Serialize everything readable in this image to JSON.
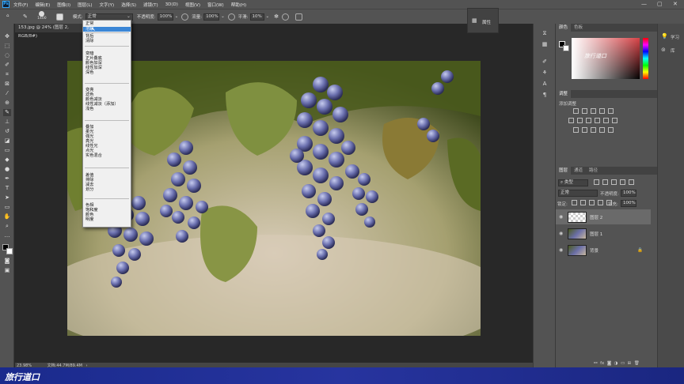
{
  "app": {
    "logo": "Ps"
  },
  "menubar": {
    "items": [
      "文件(F)",
      "编辑(E)",
      "图像(I)",
      "图层(L)",
      "文字(Y)",
      "选择(S)",
      "滤镜(T)",
      "3D(D)",
      "视图(V)",
      "窗口(W)",
      "帮助(H)"
    ]
  },
  "window_controls": {
    "minimize": "—",
    "restore": "▢",
    "close": "✕"
  },
  "options": {
    "brush_size": "1400",
    "mode_label": "模式:",
    "mode_value": "正常",
    "opacity_label": "不透明度:",
    "opacity_value": "100%",
    "flow_label": "流量:",
    "flow_value": "100%",
    "smooth_label": "平滑:",
    "smooth_value": "10%"
  },
  "document": {
    "tab_title": "153.jpg @ 24% (图层 2, RGB/8#)",
    "zoom": "23.98%",
    "doc_info": "文档:44.7M/89.4M"
  },
  "blend_dropdown": {
    "groups": [
      [
        "正常",
        "溶解"
      ],
      [
        "背后",
        "清除"
      ],
      [
        "变暗",
        "正片叠底",
        "颜色加深",
        "线性加深",
        "深色"
      ],
      [
        "变亮",
        "滤色",
        "颜色减淡",
        "线性减淡（添加）",
        "浅色"
      ],
      [
        "叠加",
        "柔光",
        "强光",
        "亮光",
        "线性光",
        "点光",
        "实色混合"
      ],
      [
        "差值",
        "排除",
        "减去",
        "划分"
      ],
      [
        "色相",
        "饱和度",
        "颜色",
        "明度"
      ]
    ],
    "selected": "溶解"
  },
  "mid_panel": {
    "properties_label": "属性"
  },
  "color_panel": {
    "tabs": [
      "颜色",
      "色板"
    ],
    "watermark": "旅行道口"
  },
  "adjustments_panel": {
    "tab": "调整",
    "subtitle": "添加调整"
  },
  "layers_panel": {
    "tabs": [
      "图层",
      "通道",
      "路径"
    ],
    "filter": "类型",
    "blend_mode": "正常",
    "opacity_label": "不透明度:",
    "opacity_value": "100%",
    "lock_label": "锁定:",
    "fill_label": "填充:",
    "fill_value": "100%",
    "layers": [
      {
        "name": "图层 2",
        "kind": "transparent"
      },
      {
        "name": "图层 1",
        "kind": "photo"
      },
      {
        "name": "背景",
        "kind": "photo",
        "locked": true
      }
    ]
  },
  "far_panel": {
    "learn": "学习",
    "library": "库"
  },
  "footer": {
    "brand": "旅行道口"
  },
  "colors": {
    "accent": "#31a8ff",
    "selection": "#3b86d6",
    "footer": "#23309a"
  }
}
